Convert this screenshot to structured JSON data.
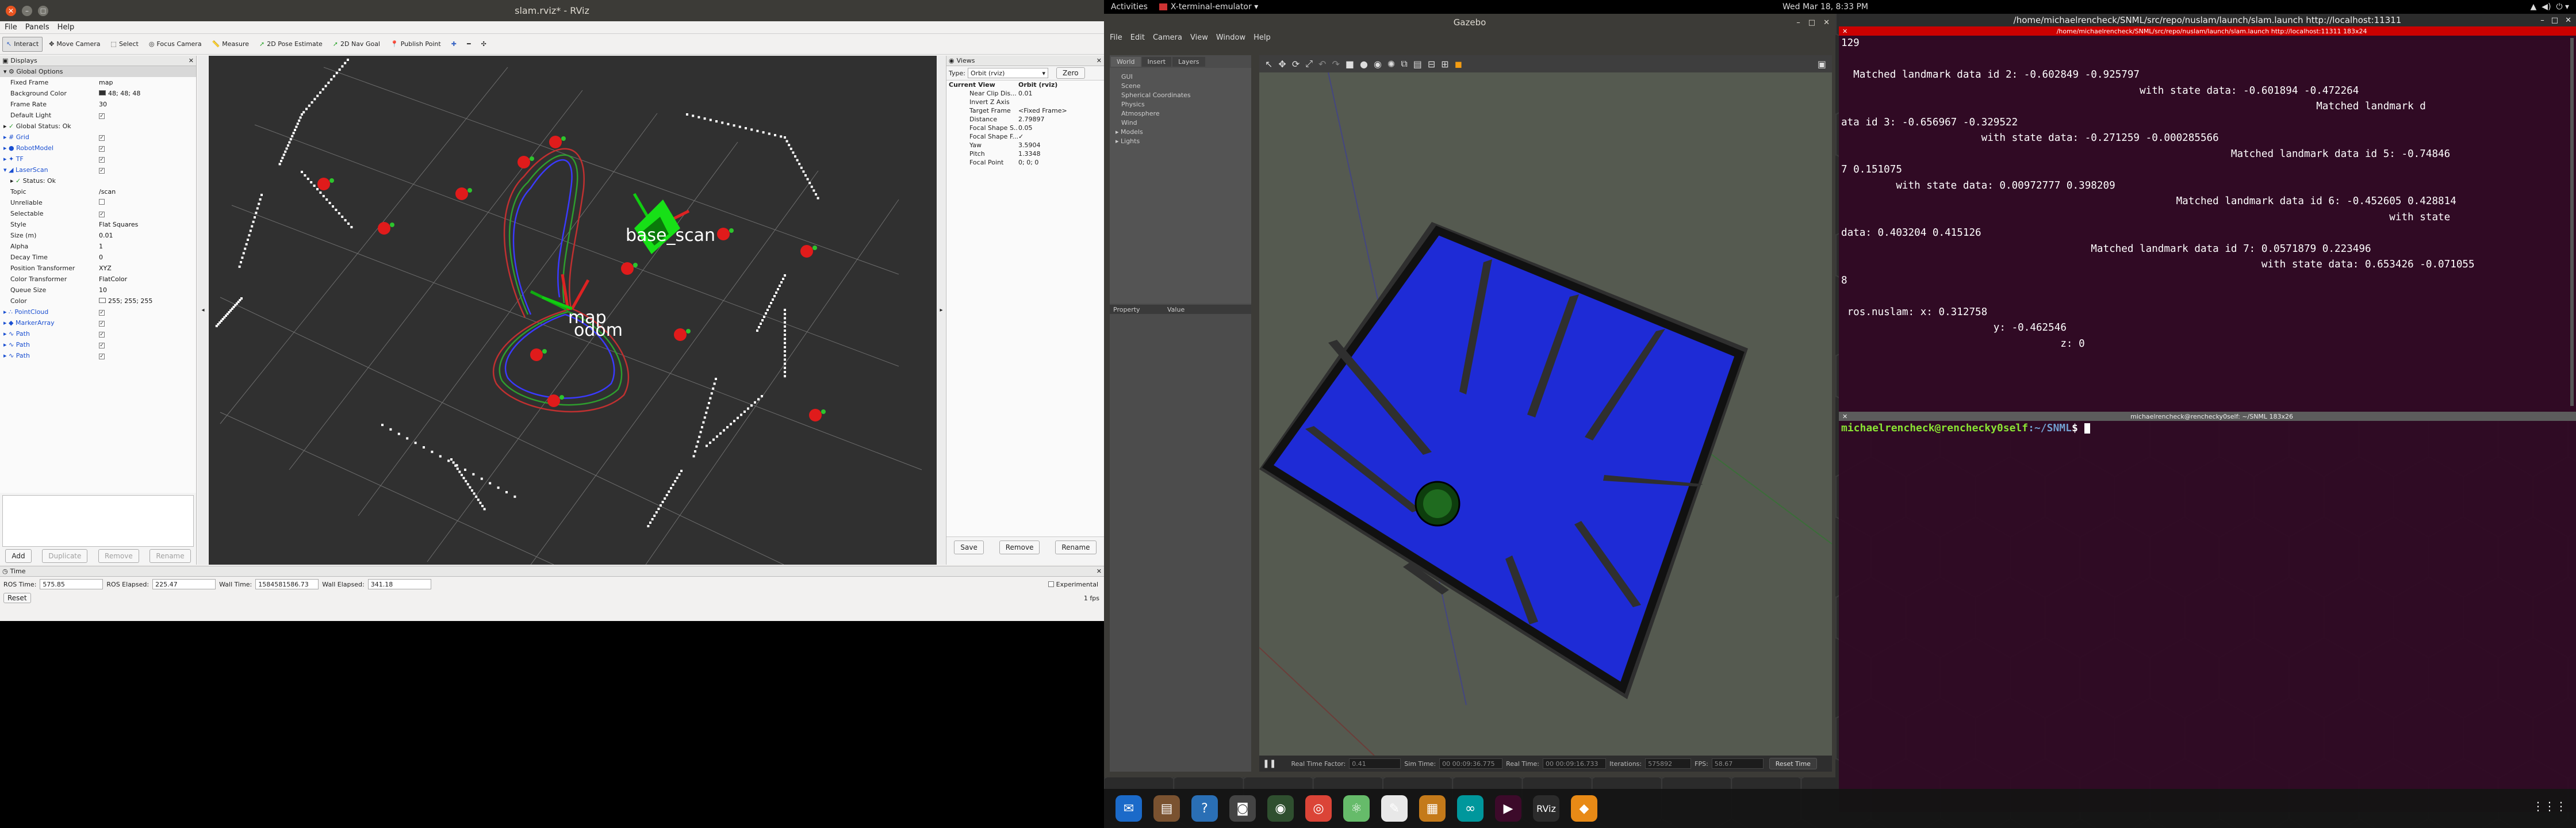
{
  "rviz": {
    "title": "slam.rviz* - RViz",
    "menu": [
      "File",
      "Panels",
      "Help"
    ],
    "toolbar": [
      "Interact",
      "Move Camera",
      "Select",
      "Focus Camera",
      "Measure",
      "2D Pose Estimate",
      "2D Nav Goal",
      "Publish Point"
    ],
    "displays": {
      "title": "Displays",
      "rows": [
        {
          "k": "Global Options",
          "v": "",
          "indent": 1,
          "exp": "▾",
          "icon": "⚙",
          "cb": ""
        },
        {
          "k": "Fixed Frame",
          "v": "map",
          "indent": 3,
          "exp": "",
          "icon": "",
          "cb": ""
        },
        {
          "k": "Background Color",
          "v": "48; 48; 48",
          "indent": 3,
          "exp": "",
          "icon": "",
          "cb": "",
          "swatch": "#303030"
        },
        {
          "k": "Frame Rate",
          "v": "30",
          "indent": 3,
          "exp": "",
          "icon": "",
          "cb": ""
        },
        {
          "k": "Default Light",
          "v": "",
          "indent": 3,
          "exp": "",
          "icon": "",
          "cb": "✓"
        },
        {
          "k": "Global Status: Ok",
          "v": "",
          "indent": 1,
          "exp": "▸",
          "icon": "✓",
          "cb": ""
        },
        {
          "k": "Grid",
          "v": "",
          "indent": 1,
          "exp": "▸",
          "icon": "#",
          "cb": "✓",
          "blue": true
        },
        {
          "k": "RobotModel",
          "v": "",
          "indent": 1,
          "exp": "▸",
          "icon": "●",
          "cb": "✓",
          "blue": true
        },
        {
          "k": "TF",
          "v": "",
          "indent": 1,
          "exp": "▸",
          "icon": "✦",
          "cb": "✓",
          "blue": true
        },
        {
          "k": "LaserScan",
          "v": "",
          "indent": 1,
          "exp": "▾",
          "icon": "◢",
          "cb": "✓",
          "blue": true
        },
        {
          "k": "Status: Ok",
          "v": "",
          "indent": 3,
          "exp": "▸",
          "icon": "✓",
          "cb": ""
        },
        {
          "k": "Topic",
          "v": "/scan",
          "indent": 3,
          "exp": "",
          "icon": "",
          "cb": ""
        },
        {
          "k": "Unreliable",
          "v": "",
          "indent": 3,
          "exp": "",
          "icon": "",
          "cb": " "
        },
        {
          "k": "Selectable",
          "v": "",
          "indent": 3,
          "exp": "",
          "icon": "",
          "cb": "✓"
        },
        {
          "k": "Style",
          "v": "Flat Squares",
          "indent": 3,
          "exp": "",
          "icon": "",
          "cb": ""
        },
        {
          "k": "Size (m)",
          "v": "0.01",
          "indent": 3,
          "exp": "",
          "icon": "",
          "cb": ""
        },
        {
          "k": "Alpha",
          "v": "1",
          "indent": 3,
          "exp": "",
          "icon": "",
          "cb": ""
        },
        {
          "k": "Decay Time",
          "v": "0",
          "indent": 3,
          "exp": "",
          "icon": "",
          "cb": ""
        },
        {
          "k": "Position Transformer",
          "v": "XYZ",
          "indent": 3,
          "exp": "",
          "icon": "",
          "cb": ""
        },
        {
          "k": "Color Transformer",
          "v": "FlatColor",
          "indent": 3,
          "exp": "",
          "icon": "",
          "cb": ""
        },
        {
          "k": "Queue Size",
          "v": "10",
          "indent": 3,
          "exp": "",
          "icon": "",
          "cb": ""
        },
        {
          "k": "Color",
          "v": "255; 255; 255",
          "indent": 3,
          "exp": "",
          "icon": "",
          "cb": "",
          "swatch": "#ffffff"
        },
        {
          "k": "PointCloud",
          "v": "",
          "indent": 1,
          "exp": "▸",
          "icon": "∴",
          "cb": "✓",
          "blue": true
        },
        {
          "k": "MarkerArray",
          "v": "",
          "indent": 1,
          "exp": "▸",
          "icon": "◆",
          "cb": "✓",
          "blue": true
        },
        {
          "k": "Path",
          "v": "",
          "indent": 1,
          "exp": "▸",
          "icon": "∿",
          "cb": "✓",
          "blue": true
        },
        {
          "k": "Path",
          "v": "",
          "indent": 1,
          "exp": "▸",
          "icon": "∿",
          "cb": "✓",
          "blue": true
        },
        {
          "k": "Path",
          "v": "",
          "indent": 1,
          "exp": "▸",
          "icon": "∿",
          "cb": "✓",
          "blue": true
        }
      ],
      "buttons": [
        "Add",
        "Duplicate",
        "Remove",
        "Rename"
      ]
    },
    "scene_labels": {
      "map": "map",
      "odom": "odom",
      "base_scan": "base_scan"
    },
    "views": {
      "title": "Views",
      "type_label": "Type:",
      "type_value": "Orbit (rviz)",
      "zero": "Zero",
      "rows": [
        {
          "k": "Current View",
          "v": "Orbit (rviz)",
          "bold": true
        },
        {
          "k": "Near Clip Dis...",
          "v": "0.01"
        },
        {
          "k": "Invert Z Axis",
          "v": ""
        },
        {
          "k": "Target Frame",
          "v": "<Fixed Frame>"
        },
        {
          "k": "Distance",
          "v": "2.79897"
        },
        {
          "k": "Focal Shape S...",
          "v": "0.05"
        },
        {
          "k": "Focal Shape F...",
          "v": "✓"
        },
        {
          "k": "Yaw",
          "v": "3.5904"
        },
        {
          "k": "Pitch",
          "v": "1.3348"
        },
        {
          "k": "Focal Point",
          "v": "0; 0; 0"
        }
      ],
      "buttons": [
        "Save",
        "Remove",
        "Rename"
      ]
    },
    "time": {
      "title": "Time",
      "ros_time_label": "ROS Time:",
      "ros_time": "575.85",
      "ros_elapsed_label": "ROS Elapsed:",
      "ros_elapsed": "225.47",
      "wall_time_label": "Wall Time:",
      "wall_time": "1584581586.73",
      "wall_elapsed_label": "Wall Elapsed:",
      "wall_elapsed": "341.18",
      "experimental": "Experimental",
      "reset": "Reset",
      "fps": "1 fps"
    }
  },
  "topbar": {
    "activities": "Activities",
    "app": "X-terminal-emulator ▾",
    "clock": "Wed Mar 18, 8:33 PM"
  },
  "gazebo": {
    "title": "Gazebo",
    "menu": [
      "File",
      "Edit",
      "Camera",
      "View",
      "Window",
      "Help"
    ],
    "tabs": [
      "World",
      "Insert",
      "Layers"
    ],
    "tree": [
      "GUI",
      "Scene",
      "Spherical Coordinates",
      "Physics",
      "Atmosphere",
      "Wind",
      "Models",
      "Lights"
    ],
    "prop_headers": [
      "Property",
      "Value"
    ],
    "status": {
      "rtf_label": "Real Time Factor:",
      "rtf": "0.41",
      "sim_label": "Sim Time:",
      "sim": "00 00:09:36.775",
      "real_label": "Real Time:",
      "real": "00 00:09:16.733",
      "iter_label": "Iterations:",
      "iter": "575892",
      "fps_label": "FPS:",
      "fps": "58.67",
      "reset": "Reset Time"
    }
  },
  "terminal1": {
    "title": "/home/michaelrencheck/SNML/src/repo/nuslam/launch/slam.launch http://localhost:11311",
    "subtitle": "/home/michaelrencheck/SNML/src/repo/nuslam/launch/slam.launch http://localhost:11311 183x24",
    "lines": [
      "129",
      "",
      "  Matched landmark data id 2: -0.602849 -0.925797",
      "                                                 with state data: -0.601894 -0.472264",
      "                                                                              Matched landmark d",
      "ata id 3: -0.656967 -0.329522",
      "                       with state data: -0.271259 -0.000285566",
      "                                                                Matched landmark data id 5: -0.74846",
      "7 0.151075",
      "         with state data: 0.00972777 0.398209",
      "                                                       Matched landmark data id 6: -0.452605 0.428814",
      "                                                                                          with state",
      "data: 0.403204 0.415126",
      "                                         Matched landmark data id 7: 0.0571879 0.223496",
      "                                                                     with state data: 0.653426 -0.071055",
      "8",
      "",
      " ros.nuslam: x: 0.312758",
      "                         y: -0.462546",
      "                                    z: 0"
    ]
  },
  "terminal2": {
    "subtitle": "michaelrencheck@renchecky0self: ~/SNML 183x26",
    "prompt_user": "michaelrencheck@renchecky0self",
    "prompt_path": ":~/SNML",
    "prompt_end": "$ "
  },
  "dock": {
    "icons": [
      "Thunderbird",
      "Files",
      "Help",
      "Screenshot",
      "Terminal-dark",
      "Chrome",
      "Atom",
      "Inkscape",
      "Files-dark",
      "Arduino",
      "Terminal",
      "RViz",
      "Layers"
    ],
    "rviz_label": "RViz"
  },
  "colors": {
    "rviz_bg": "#303030",
    "gazebo_blue": "#1e2bd6",
    "terminal_bg": "#300a24",
    "prompt_green": "#8ae234",
    "prompt_blue": "#729fcf"
  }
}
